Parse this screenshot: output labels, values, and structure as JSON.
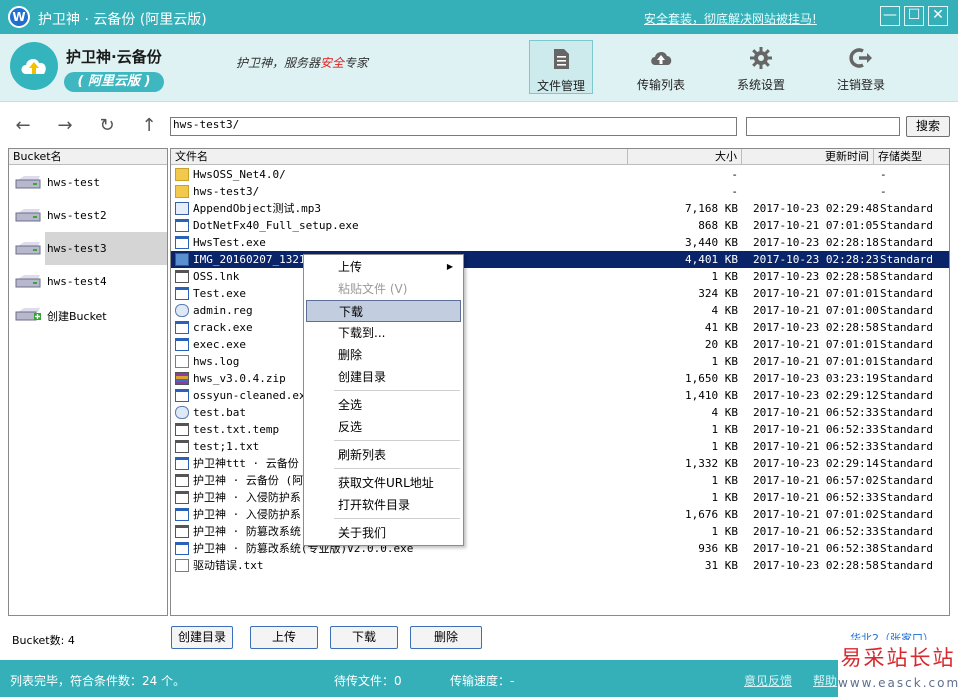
{
  "window": {
    "title": "护卫神 · 云备份 (阿里云版)",
    "promo_link": "安全套装，彻底解决网站被挂马!",
    "min_glyph": "—",
    "max_glyph": "☐",
    "close_glyph": "✕"
  },
  "header": {
    "brand_name": "护卫神·云备份",
    "brand_sub": "( 阿里云版 )",
    "slogan_prefix": "护卫神，服务器",
    "slogan_accent": "安全",
    "slogan_suffix": "专家",
    "tabs": [
      {
        "label": "文件管理",
        "icon": "document-icon",
        "active": true
      },
      {
        "label": "传输列表",
        "icon": "cloud-upload-icon",
        "active": false
      },
      {
        "label": "系统设置",
        "icon": "gear-icon",
        "active": false
      },
      {
        "label": "注销登录",
        "icon": "logout-icon",
        "active": false
      }
    ]
  },
  "toolbar": {
    "back_glyph": "←",
    "forward_glyph": "→",
    "refresh_glyph": "↻",
    "up_glyph": "↑",
    "path": "hws-test3/",
    "search_value": "",
    "search_label": "搜索"
  },
  "buckets": {
    "header": "Bucket名",
    "items": [
      {
        "label": "hws-test",
        "selected": false
      },
      {
        "label": "hws-test2",
        "selected": false
      },
      {
        "label": "hws-test3",
        "selected": true
      },
      {
        "label": "hws-test4",
        "selected": false
      },
      {
        "label": "创建Bucket",
        "selected": false
      }
    ],
    "count_label": "Bucket数: 4"
  },
  "files": {
    "columns": [
      "文件名",
      "大小",
      "更新时间",
      "存储类型"
    ],
    "rows": [
      {
        "icon": "folder-icon",
        "name": "HwsOSS_Net4.0/",
        "size": "-",
        "time": "",
        "class": "-"
      },
      {
        "icon": "folder-icon",
        "name": "hws-test3/",
        "size": "-",
        "time": "",
        "class": "-"
      },
      {
        "icon": "mp3-icon",
        "name": "AppendObject测试.mp3",
        "size": "7,168 KB",
        "time": "2017-10-23 02:29:48",
        "class": "Standard"
      },
      {
        "icon": "exe-icon",
        "name": "DotNetFx40_Full_setup.exe",
        "size": "868 KB",
        "time": "2017-10-21 07:01:05",
        "class": "Standard"
      },
      {
        "icon": "exe-icon",
        "name": "HwsTest.exe",
        "size": "3,440 KB",
        "time": "2017-10-23 02:28:18",
        "class": "Standard"
      },
      {
        "icon": "image-icon",
        "name": "IMG_20160207_132156",
        "size": "4,401 KB",
        "time": "2017-10-23 02:28:23",
        "class": "Standard",
        "selected": true
      },
      {
        "icon": "text-icon",
        "name": "OSS.lnk",
        "size": "1 KB",
        "time": "2017-10-23 02:28:58",
        "class": "Standard"
      },
      {
        "icon": "exe-icon",
        "name": "Test.exe",
        "size": "324 KB",
        "time": "2017-10-21 07:01:01",
        "class": "Standard"
      },
      {
        "icon": "registry-icon",
        "name": "admin.reg",
        "size": "4 KB",
        "time": "2017-10-21 07:01:00",
        "class": "Standard"
      },
      {
        "icon": "exe-icon",
        "name": "crack.exe",
        "size": "41 KB",
        "time": "2017-10-23 02:28:58",
        "class": "Standard"
      },
      {
        "icon": "exe-icon",
        "name": "exec.exe",
        "size": "20 KB",
        "time": "2017-10-21 07:01:01",
        "class": "Standard"
      },
      {
        "icon": "file-icon",
        "name": "hws.log",
        "size": "1 KB",
        "time": "2017-10-21 07:01:01",
        "class": "Standard"
      },
      {
        "icon": "archive-icon",
        "name": "hws_v3.0.4.zip",
        "size": "1,650 KB",
        "time": "2017-10-23 03:23:19",
        "class": "Standard"
      },
      {
        "icon": "exe-icon",
        "name": "ossyun-cleaned.exe",
        "size": "1,410 KB",
        "time": "2017-10-23 02:29:12",
        "class": "Standard"
      },
      {
        "icon": "batch-icon",
        "name": "test.bat",
        "size": "4 KB",
        "time": "2017-10-21 06:52:33",
        "class": "Standard"
      },
      {
        "icon": "text-icon",
        "name": "test.txt.temp",
        "size": "1 KB",
        "time": "2017-10-21 06:52:33",
        "class": "Standard"
      },
      {
        "icon": "text-icon",
        "name": "test;1.txt",
        "size": "1 KB",
        "time": "2017-10-21 06:52:33",
        "class": "Standard"
      },
      {
        "icon": "exe-icon",
        "name": "护卫神ttt · 云备份 (",
        "size": "1,332 KB",
        "time": "2017-10-23 02:29:14",
        "class": "Standard"
      },
      {
        "icon": "text-icon",
        "name": "护卫神 · 云备份 (阿里",
        "size": "1 KB",
        "time": "2017-10-21 06:57:02",
        "class": "Standard"
      },
      {
        "icon": "text-icon",
        "name": "护卫神 · 入侵防护系",
        "size": "1 KB",
        "time": "2017-10-21 06:52:33",
        "class": "Standard"
      },
      {
        "icon": "exe-icon",
        "name": "护卫神 · 入侵防护系",
        "size": "1,676 KB",
        "time": "2017-10-21 07:01:02",
        "class": "Standard"
      },
      {
        "icon": "text-icon",
        "name": "护卫神 · 防篡改系统",
        "size": "1 KB",
        "time": "2017-10-21 06:52:33",
        "class": "Standard"
      },
      {
        "icon": "exe-icon",
        "name": "护卫神 · 防篡改系统(专业版)V2.0.0.exe",
        "size": "936 KB",
        "time": "2017-10-21 06:52:38",
        "class": "Standard"
      },
      {
        "icon": "file-icon",
        "name": "驱动错误.txt",
        "size": "31 KB",
        "time": "2017-10-23 02:28:58",
        "class": "Standard"
      }
    ]
  },
  "context_menu": {
    "items": [
      {
        "label": "上传",
        "submenu": true,
        "disabled": false,
        "hover": false
      },
      {
        "label": "粘贴文件 (V)",
        "submenu": false,
        "disabled": true,
        "hover": false
      },
      {
        "label": "下载",
        "submenu": false,
        "disabled": false,
        "hover": true
      },
      {
        "label": "下载到...",
        "submenu": false,
        "disabled": false,
        "hover": false
      },
      {
        "label": "删除",
        "submenu": false,
        "disabled": false,
        "hover": false
      },
      {
        "label": "创建目录",
        "submenu": false,
        "disabled": false,
        "hover": false
      },
      {
        "label": "全选",
        "submenu": false,
        "disabled": false,
        "hover": false
      },
      {
        "label": "反选",
        "submenu": false,
        "disabled": false,
        "hover": false
      },
      {
        "label": "刷新列表",
        "submenu": false,
        "disabled": false,
        "hover": false
      },
      {
        "label": "获取文件URL地址",
        "submenu": false,
        "disabled": false,
        "hover": false
      },
      {
        "label": "打开软件目录",
        "submenu": false,
        "disabled": false,
        "hover": false
      },
      {
        "label": "关于我们",
        "submenu": false,
        "disabled": false,
        "hover": false
      }
    ],
    "submenu_glyph": "▶"
  },
  "actions": {
    "create_dir": "创建目录",
    "upload": "上传",
    "download": "下载",
    "delete": "删除",
    "bottom_link": "华北2（张家口）"
  },
  "status": {
    "text": "列表完毕，符合条件数：24 个。",
    "pending": "待传文件：0",
    "speed": "传输速度：-",
    "feedback": "意见反馈",
    "help": "帮助"
  },
  "watermark": {
    "title": "易采站长站",
    "url": "www.easck.com"
  },
  "colors": {
    "accent": "#35b0b9",
    "selection": "#0a246a",
    "slogan_accent": "#e02020",
    "watermark": "#d8292f"
  }
}
